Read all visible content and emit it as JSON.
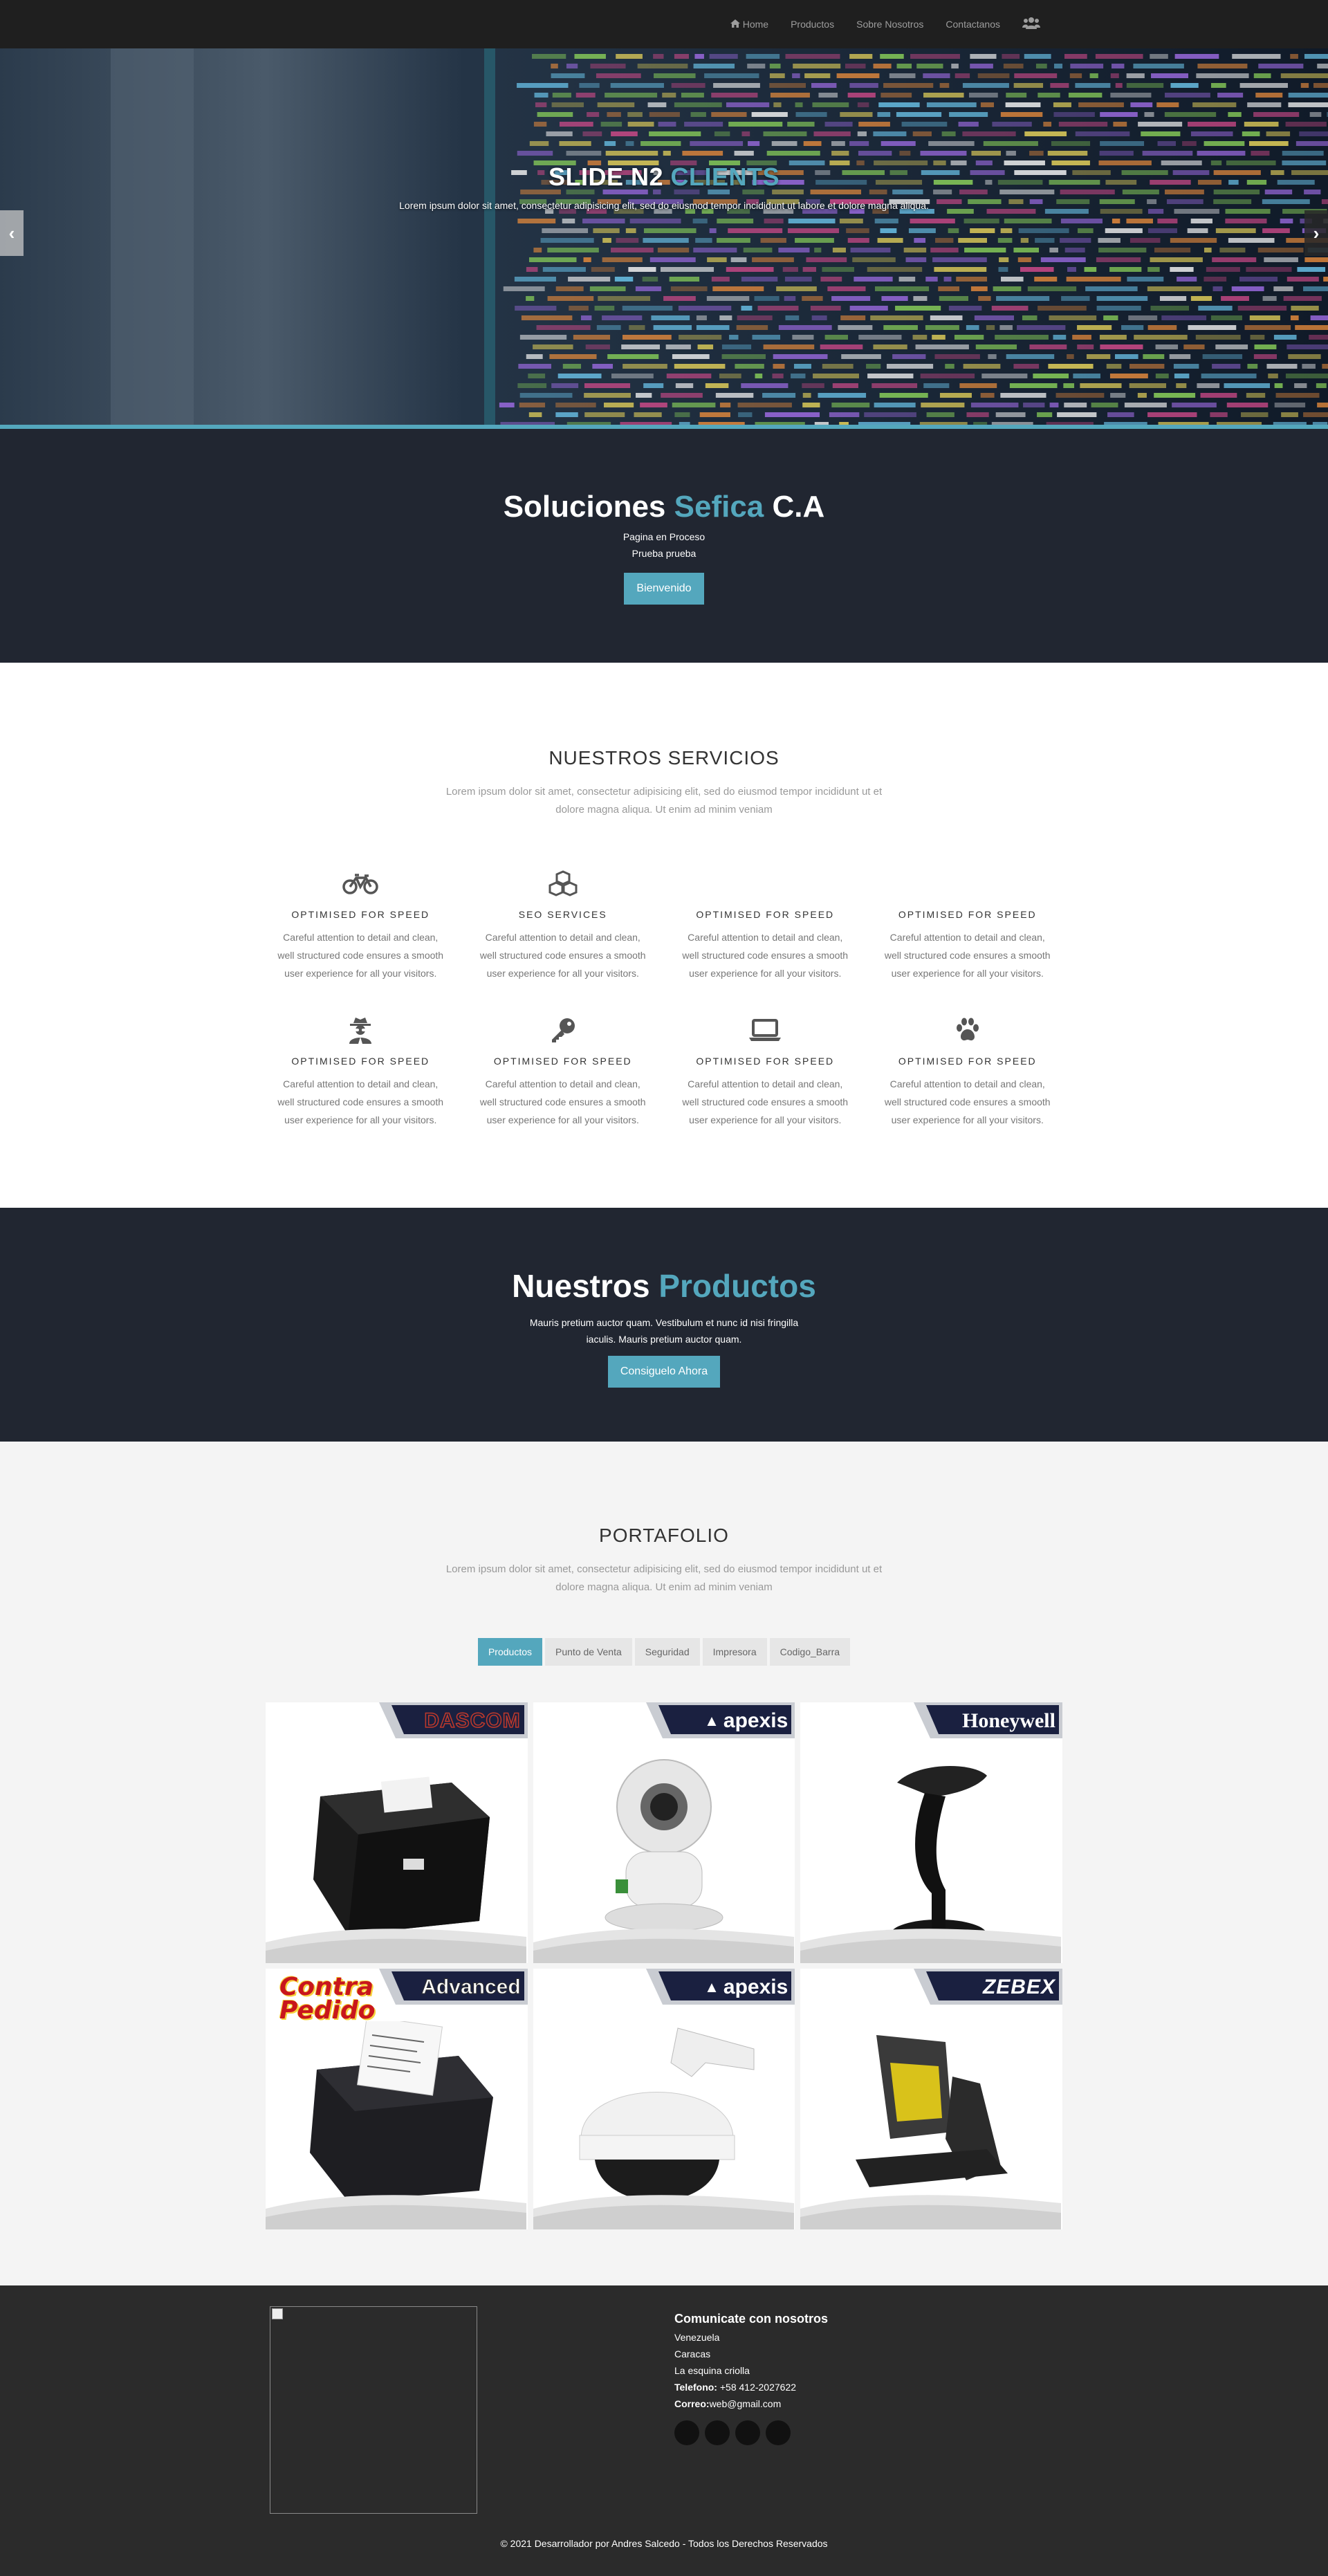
{
  "nav": {
    "items": [
      {
        "label": "Home",
        "icon": "home-icon"
      },
      {
        "label": "Productos"
      },
      {
        "label": "Sobre Nosotros"
      },
      {
        "label": "Contactanos"
      }
    ],
    "user_icon": "users-icon"
  },
  "hero": {
    "title_main": "SLIDE N2",
    "title_accent": "CLIENTS",
    "subtitle": "Lorem ipsum dolor sit amet, consectetur adipisicing elit, sed do eiusmod tempor incididunt ut labore et dolore magna aliqua."
  },
  "soluciones": {
    "title_a": "Soluciones",
    "title_accent": "Sefica",
    "title_b": "C.A",
    "line1": "Pagina en Proceso",
    "line2": "Prueba prueba",
    "button": "Bienvenido"
  },
  "services": {
    "title": "NUESTROS SERVICIOS",
    "desc": "Lorem ipsum dolor sit amet, consectetur adipisicing elit, sed do eiusmod tempor incididunt ut et dolore magna aliqua. Ut enim ad minim veniam",
    "items": [
      {
        "icon": "bicycle-icon",
        "title": "OPTIMISED FOR SPEED",
        "text": "Careful attention to detail and clean, well structured code ensures a smooth user experience for all your visitors."
      },
      {
        "icon": "cubes-icon",
        "title": "SEO SERVICES",
        "text": "Careful attention to detail and clean, well structured code ensures a smooth user experience for all your visitors."
      },
      {
        "icon": "",
        "title": "OPTIMISED FOR SPEED",
        "text": "Careful attention to detail and clean, well structured code ensures a smooth user experience for all your visitors."
      },
      {
        "icon": "",
        "title": "OPTIMISED FOR SPEED",
        "text": "Careful attention to detail and clean, well structured code ensures a smooth user experience for all your visitors."
      },
      {
        "icon": "user-secret-icon",
        "title": "OPTIMISED FOR SPEED",
        "text": "Careful attention to detail and clean, well structured code ensures a smooth user experience for all your visitors."
      },
      {
        "icon": "key-icon",
        "title": "OPTIMISED FOR SPEED",
        "text": "Careful attention to detail and clean, well structured code ensures a smooth user experience for all your visitors."
      },
      {
        "icon": "laptop-icon",
        "title": "OPTIMISED FOR SPEED",
        "text": "Careful attention to detail and clean, well structured code ensures a smooth user experience for all your visitors."
      },
      {
        "icon": "paw-icon",
        "title": "OPTIMISED FOR SPEED",
        "text": "Careful attention to detail and clean, well structured code ensures a smooth user experience for all your visitors."
      }
    ]
  },
  "productos": {
    "title_a": "Nuestros",
    "title_accent": "Productos",
    "sub": "Mauris pretium auctor quam. Vestibulum et nunc id nisi fringilla iaculis. Mauris pretium auctor quam.",
    "button": "Consiguelo Ahora"
  },
  "portfolio": {
    "title": "PORTAFOLIO",
    "desc": "Lorem ipsum dolor sit amet, consectetur adipisicing elit, sed do eiusmod tempor incididunt ut et dolore magna aliqua. Ut enim ad minim veniam",
    "filters": [
      "Productos",
      "Punto de Venta",
      "Seguridad",
      "Impresora",
      "Codigo_Barra"
    ],
    "cards": [
      {
        "brand": "DASCOM",
        "product": "receipt-printer"
      },
      {
        "brand": "apexis",
        "product": "ip-camera"
      },
      {
        "brand": "Honeywell",
        "product": "barcode-scanner"
      },
      {
        "brand": "Advanced",
        "promo": "Contra Pedido",
        "product": "receipt-printer-with-ticket"
      },
      {
        "brand": "apexis",
        "product": "dome-camera"
      },
      {
        "brand": "ZEBEX",
        "product": "omni-scanner"
      }
    ]
  },
  "footer": {
    "contact_title": "Comunicate con nosotros",
    "country": "Venezuela",
    "city": "Caracas",
    "area": "La esquina criolla",
    "phone_label": "Telefono:",
    "phone": " +58 412-2027622",
    "email_label": "Correo:",
    "email": "web@gmail.com",
    "copyright": "© 2021 Desarrollador por Andres Salcedo - Todos los Derechos Reservados"
  },
  "colors": {
    "accent": "#54a7bd",
    "dark_band": "#212631",
    "nav": "#1f1f1f",
    "footer": "#2b2b2b"
  }
}
